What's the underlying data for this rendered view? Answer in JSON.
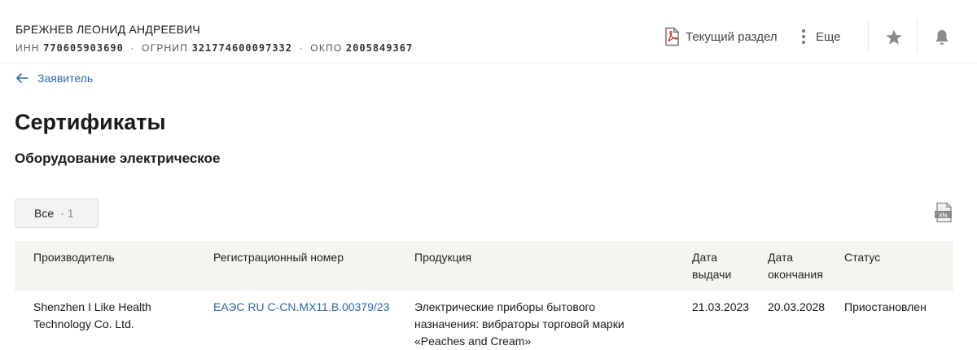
{
  "header": {
    "company_name": "БРЕЖНЕВ ЛЕОНИД АНДРЕЕВИЧ",
    "inn_label": "ИНН",
    "inn_value": "770605903690",
    "ogrnip_label": "ОГРНИП",
    "ogrnip_value": "321774600097332",
    "okpo_label": "ОКПО",
    "okpo_value": "2005849367",
    "separator": "·",
    "current_section_label": "Текущий раздел",
    "more_label": "Еще"
  },
  "nav": {
    "back_label": "Заявитель"
  },
  "page": {
    "title": "Сертификаты",
    "subtitle": "Оборудование электрическое"
  },
  "filters": {
    "all_label": "Все",
    "separator": "·",
    "all_count": "1"
  },
  "table": {
    "headers": {
      "manufacturer": "Производитель",
      "reg_number": "Регистрационный номер",
      "product": "Продукция",
      "issue_date_1": "Дата",
      "issue_date_2": "выдачи",
      "end_date_1": "Дата",
      "end_date_2": "окончания",
      "status": "Статус"
    },
    "rows": [
      {
        "manufacturer_1": "Shenzhen I Like Health",
        "manufacturer_2": "Technology Co. Ltd.",
        "reg_number": "ЕАЭС RU С-CN.МХ11.В.00379/23",
        "product_1": "Электрические приборы бытового",
        "product_2": "назначения: вибраторы торговой марки",
        "product_3": "«Peaches and Cream»",
        "issue_date": "21.03.2023",
        "end_date": "20.03.2028",
        "status": "Приостановлен"
      }
    ]
  },
  "icons": {
    "pdf": "pdf-file-icon",
    "more": "vertical-dots-icon",
    "favorite": "star-icon",
    "notify": "bell-icon",
    "back": "arrow-left-icon",
    "export": "xls-file-icon"
  },
  "colors": {
    "link": "#2c6aa8",
    "header_bg": "#f6f4f0",
    "icon_gray": "#8a8a8a"
  }
}
